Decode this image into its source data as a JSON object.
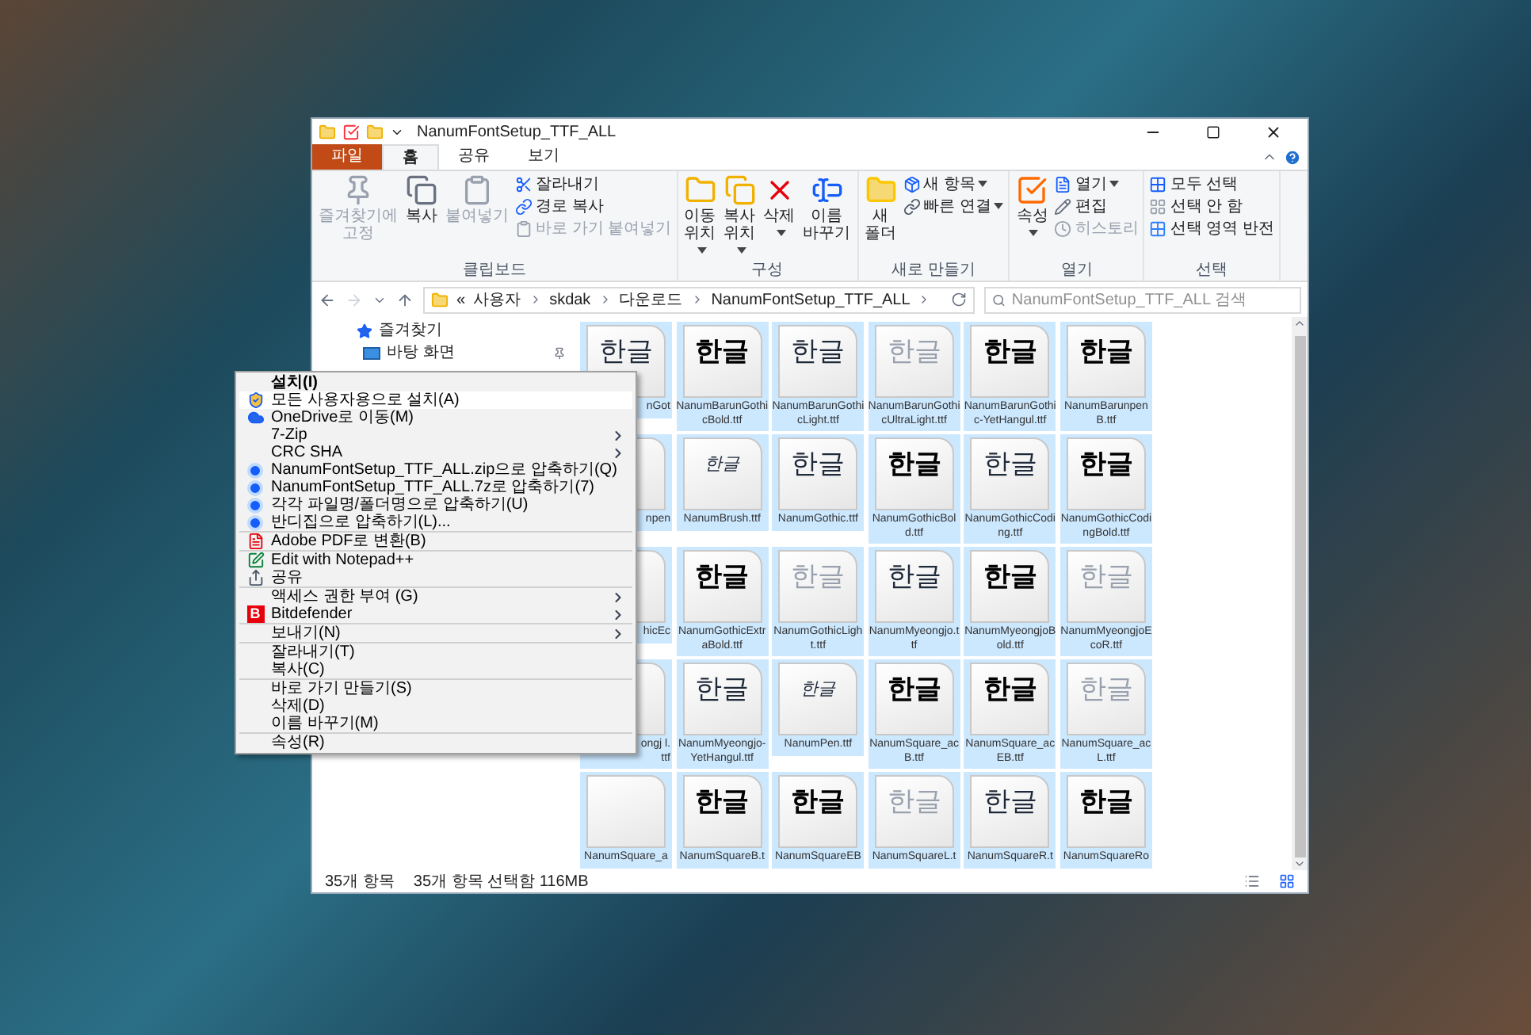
{
  "window": {
    "title": "NanumFontSetup_TTF_ALL"
  },
  "tabs": [
    {
      "label": "파일",
      "kind": "file",
      "selected": false
    },
    {
      "label": "홈",
      "kind": "tab",
      "selected": true
    },
    {
      "label": "공유",
      "kind": "tab",
      "selected": false
    },
    {
      "label": "보기",
      "kind": "tab",
      "selected": false
    }
  ],
  "ribbon": [
    {
      "title": "클립보드",
      "large": [
        {
          "label": "즐겨찾기에 고정",
          "dropdown": false,
          "disabled": true
        },
        {
          "label": "복사",
          "dropdown": false,
          "disabled": false
        },
        {
          "label": "붙여넣기",
          "dropdown": false,
          "disabled": true
        }
      ],
      "small": [
        {
          "label": "잘라내기",
          "dropdown": false,
          "disabled": false
        },
        {
          "label": "경로 복사",
          "dropdown": false,
          "disabled": false
        },
        {
          "label": "바로 가기 붙여넣기",
          "dropdown": false,
          "disabled": true
        }
      ]
    },
    {
      "title": "구성",
      "large": [
        {
          "label": "이동 위치",
          "dropdown": true,
          "disabled": false
        },
        {
          "label": "복사 위치",
          "dropdown": true,
          "disabled": false
        },
        {
          "label": "삭제",
          "dropdown": true,
          "disabled": false
        },
        {
          "label": "이름 바꾸기",
          "dropdown": false,
          "disabled": false
        }
      ]
    },
    {
      "title": "새로 만들기",
      "large": [
        {
          "label": "새 폴더",
          "dropdown": false,
          "disabled": false
        }
      ],
      "small": [
        {
          "label": "새 항목",
          "dropdown": true,
          "disabled": false
        },
        {
          "label": "빠른 연결",
          "dropdown": true,
          "disabled": false
        }
      ]
    },
    {
      "title": "열기",
      "large": [
        {
          "label": "속성",
          "dropdown": true,
          "disabled": false
        }
      ],
      "small": [
        {
          "label": "열기",
          "dropdown": true,
          "disabled": false
        },
        {
          "label": "편집",
          "dropdown": false,
          "disabled": false
        },
        {
          "label": "히스토리",
          "dropdown": false,
          "disabled": true
        }
      ]
    },
    {
      "title": "선택",
      "small": [
        {
          "label": "모두 선택",
          "dropdown": false,
          "disabled": false
        },
        {
          "label": "선택 안 함",
          "dropdown": false,
          "disabled": false
        },
        {
          "label": "선택 영역 반전",
          "dropdown": false,
          "disabled": false
        }
      ]
    }
  ],
  "address": {
    "overflow": "«",
    "path": [
      "사용자",
      "skdak",
      "다운로드",
      "NanumFontSetup_TTF_ALL"
    ],
    "search_placeholder": "NanumFontSetup_TTF_ALL 검색"
  },
  "nav_pane": [
    {
      "label": "즐겨찾기",
      "kind": "header",
      "pinned": false
    },
    {
      "label": "바탕 화면",
      "kind": "item",
      "pinned": true
    }
  ],
  "files": [
    {
      "label": "nGot",
      "partial": true,
      "preview": "한글",
      "kind": "regular",
      "selected": true
    },
    {
      "label": "NanumBarunGothicBold.ttf",
      "preview": "한글",
      "kind": "bold",
      "selected": true
    },
    {
      "label": "NanumBarunGothicLight.ttf",
      "preview": "한글",
      "kind": "regular",
      "selected": true
    },
    {
      "label": "NanumBarunGothicUltraLight.ttf",
      "preview": "한글",
      "kind": "light",
      "selected": true
    },
    {
      "label": "NanumBarunGothic-YetHangul.ttf",
      "preview": "한글",
      "kind": "bold",
      "selected": true
    },
    {
      "label": "NanumBarunpenB.ttf",
      "preview": "한글",
      "kind": "bold",
      "selected": true
    },
    {
      "label": "npen",
      "partial": true,
      "selected": true
    },
    {
      "label": "NanumBrush.ttf",
      "preview": "한글",
      "kind": "brush",
      "selected": true
    },
    {
      "label": "NanumGothic.ttf",
      "preview": "한글",
      "kind": "regular",
      "selected": true
    },
    {
      "label": "NanumGothicBold.ttf",
      "preview": "한글",
      "kind": "bold",
      "selected": true
    },
    {
      "label": "NanumGothicCoding.ttf",
      "preview": "한글",
      "kind": "regular",
      "selected": true
    },
    {
      "label": "NanumGothicCodingBold.ttf",
      "preview": "한글",
      "kind": "bold",
      "selected": true
    },
    {
      "label": "hicEc",
      "partial": true,
      "selected": true
    },
    {
      "label": "NanumGothicExtraBold.ttf",
      "preview": "한글",
      "kind": "bold",
      "selected": true
    },
    {
      "label": "NanumGothicLight.ttf",
      "preview": "한글",
      "kind": "light",
      "selected": true
    },
    {
      "label": "NanumMyeongjo.ttf",
      "preview": "한글",
      "kind": "regular",
      "selected": true
    },
    {
      "label": "NanumMyeongjoBold.ttf",
      "preview": "한글",
      "kind": "bold",
      "selected": true
    },
    {
      "label": "NanumMyeongjoEcoR.ttf",
      "preview": "한글",
      "kind": "light",
      "selected": true
    },
    {
      "label": "ongj l.ttf",
      "partial": true,
      "selected": true
    },
    {
      "label": "NanumMyeongjo-YetHangul.ttf",
      "preview": "한글",
      "kind": "regular",
      "selected": true
    },
    {
      "label": "NanumPen.ttf",
      "preview": "한글",
      "kind": "brush",
      "selected": true
    },
    {
      "label": "NanumSquare_acB.ttf",
      "preview": "한글",
      "kind": "bold",
      "selected": true
    },
    {
      "label": "NanumSquare_acEB.ttf",
      "preview": "한글",
      "kind": "bold",
      "selected": true
    },
    {
      "label": "NanumSquare_acL.ttf",
      "preview": "한글",
      "kind": "light",
      "selected": true
    },
    {
      "label": "NanumSquare_a",
      "selected": true
    },
    {
      "label": "NanumSquareB.t",
      "preview": "한글",
      "kind": "bold",
      "selected": true
    },
    {
      "label": "NanumSquareEB",
      "preview": "한글",
      "kind": "bold",
      "selected": true
    },
    {
      "label": "NanumSquareL.t",
      "preview": "한글",
      "kind": "light",
      "selected": true
    },
    {
      "label": "NanumSquareR.t",
      "preview": "한글",
      "kind": "regular",
      "selected": true
    },
    {
      "label": "NanumSquareRo",
      "preview": "한글",
      "kind": "bold",
      "selected": true
    }
  ],
  "status_bar": {
    "count": "35개 항목",
    "selection": "35개 항목 선택함 116MB"
  },
  "context_menu": {
    "groups": [
      {
        "items": [
          {
            "label": "설치(I)",
            "bold": true,
            "submenu": false,
            "selected": false
          },
          {
            "label": "모든 사용자용으로 설치(A)",
            "submenu": false,
            "selected": true
          },
          {
            "label": "OneDrive로 이동(M)",
            "submenu": false,
            "selected": false
          },
          {
            "label": "7-Zip",
            "submenu": true,
            "selected": false
          },
          {
            "label": "CRC SHA",
            "submenu": true,
            "selected": false
          },
          {
            "label": "NanumFontSetup_TTF_ALL.zip으로 압축하기(Q)",
            "submenu": false,
            "selected": false
          },
          {
            "label": "NanumFontSetup_TTF_ALL.7z로 압축하기(7)",
            "submenu": false,
            "selected": false
          },
          {
            "label": "각각 파일명/폴더명으로 압축하기(U)",
            "submenu": false,
            "selected": false
          },
          {
            "label": "반디집으로 압축하기(L)...",
            "submenu": false,
            "selected": false
          }
        ]
      },
      {
        "items": [
          {
            "label": "Adobe PDF로 변환(B)",
            "submenu": false,
            "selected": false
          }
        ]
      },
      {
        "items": [
          {
            "label": "Edit with Notepad++",
            "submenu": false,
            "selected": false
          },
          {
            "label": "공유",
            "submenu": false,
            "selected": false
          }
        ]
      },
      {
        "items": [
          {
            "label": "액세스 권한 부여 (G)",
            "submenu": true,
            "selected": false
          },
          {
            "label": "Bitdefender",
            "icon_text": "B",
            "submenu": true,
            "selected": false
          }
        ]
      },
      {
        "items": [
          {
            "label": "보내기(N)",
            "submenu": true,
            "selected": false
          }
        ]
      },
      {
        "items": [
          {
            "label": "잘라내기(T)",
            "submenu": false,
            "selected": false
          },
          {
            "label": "복사(C)",
            "submenu": false,
            "selected": false
          }
        ]
      },
      {
        "items": [
          {
            "label": "바로 가기 만들기(S)",
            "submenu": false,
            "selected": false
          },
          {
            "label": "삭제(D)",
            "submenu": false,
            "selected": false
          },
          {
            "label": "이름 바꾸기(M)",
            "submenu": false,
            "selected": false
          }
        ]
      },
      {
        "items": [
          {
            "label": "속성(R)",
            "submenu": false,
            "selected": false
          }
        ]
      }
    ]
  }
}
